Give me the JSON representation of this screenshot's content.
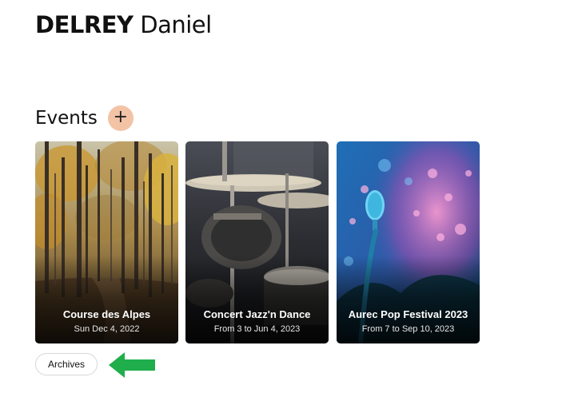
{
  "person": {
    "last_name": "DELREY",
    "first_name": "Daniel"
  },
  "events": {
    "title": "Events",
    "add_label": "+",
    "items": [
      {
        "title": "Course des Alpes",
        "date": "Sun Dec 4, 2022"
      },
      {
        "title": "Concert Jazz'n Dance",
        "date": "From 3 to Jun 4, 2023"
      },
      {
        "title": "Aurec Pop Festival 2023",
        "date": "From 7 to Sep 10, 2023"
      }
    ]
  },
  "archives_label": "Archives",
  "colors": {
    "add_button": "#f3c3a6",
    "arrow": "#1fae4b"
  }
}
